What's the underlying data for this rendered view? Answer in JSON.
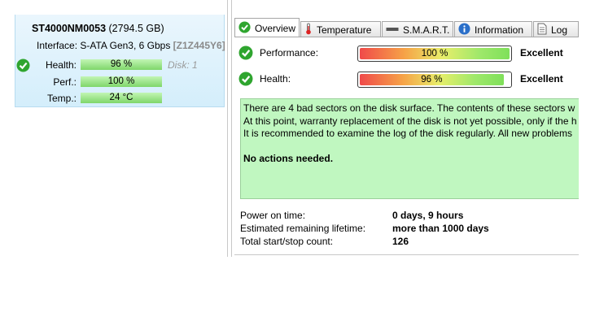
{
  "disk": {
    "model": "ST4000NM0053",
    "capacity": "(2794.5 GB)",
    "interface_label": "Interface:",
    "interface_value": "S-ATA Gen3, 6 Gbps",
    "serial": "[Z1Z445Y6]",
    "disk_number": "Disk: 1",
    "metrics": [
      {
        "label": "Health:",
        "value": "96 %",
        "fill_fraction": 0.96
      },
      {
        "label": "Perf.:",
        "value": "100 %",
        "fill_fraction": 1.0
      },
      {
        "label": "Temp.:",
        "value": "24 °C",
        "fill_fraction": 1.0
      }
    ]
  },
  "tabs": [
    {
      "label": "Overview",
      "icon": "check-icon",
      "active": true
    },
    {
      "label": "Temperature",
      "icon": "thermometer-icon",
      "active": false
    },
    {
      "label": "S.M.A.R.T.",
      "icon": "drive-icon",
      "active": false
    },
    {
      "label": "Information",
      "icon": "info-icon",
      "active": false
    },
    {
      "label": "Log",
      "icon": "document-icon",
      "active": false
    }
  ],
  "overview": {
    "performance": {
      "label": "Performance:",
      "value": "100 %",
      "fraction": 1.0,
      "rating": "Excellent"
    },
    "health": {
      "label": "Health:",
      "value": "96 %",
      "fraction": 0.96,
      "rating": "Excellent"
    }
  },
  "message": {
    "lines": [
      "There are 4 bad sectors on the disk surface. The contents of these sectors w",
      "At this point, warranty replacement of the disk is not yet possible, only if the h",
      "It is recommended to examine the log of the disk regularly. All new problems"
    ],
    "conclusion": "No actions needed.",
    "background_color": "#c0f7c0"
  },
  "stats": [
    {
      "label": "Power on time:",
      "value": "0 days, 9 hours"
    },
    {
      "label": "Estimated remaining lifetime:",
      "value": "more than 1000 days"
    },
    {
      "label": "Total start/stop count:",
      "value": "126"
    }
  ],
  "colors": {
    "accent_green": "#2fa52f",
    "panel_blue": "#d4eefb",
    "bar_green": "#7fd66a"
  }
}
